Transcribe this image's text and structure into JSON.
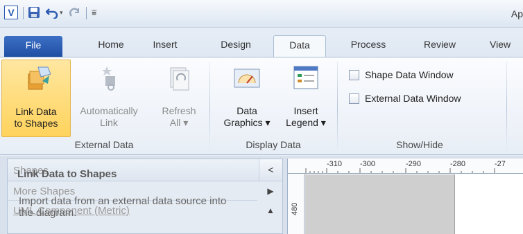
{
  "titlebar": {
    "app_initial": "V",
    "title": "Ap"
  },
  "tabs": [
    {
      "label": "File"
    },
    {
      "label": "Home"
    },
    {
      "label": "Insert"
    },
    {
      "label": "Design"
    },
    {
      "label": "Data"
    },
    {
      "label": "Process"
    },
    {
      "label": "Review"
    },
    {
      "label": "View"
    }
  ],
  "ribbon": {
    "buttons": {
      "link_data": {
        "line1": "Link Data",
        "line2": "to Shapes"
      },
      "auto_link": {
        "line1": "Automatically",
        "line2": "Link"
      },
      "refresh_all": {
        "line1": "Refresh",
        "line2": "All ▾"
      },
      "data_graphics": {
        "line1": "Data",
        "line2": "Graphics ▾"
      },
      "insert_legend": {
        "line1": "Insert",
        "line2": "Legend ▾"
      }
    },
    "checkboxes": {
      "shape_data_window": "Shape Data Window",
      "external_data_window": "External Data Window"
    },
    "groups": {
      "external_data": "External Data",
      "display_data": "Display Data",
      "show_hide": "Show/Hide"
    }
  },
  "shapes_pane": {
    "header": "Shapes",
    "collapse_glyph": "<",
    "rows": [
      {
        "label": "More Shapes",
        "arrow": "▶"
      },
      {
        "label": "UML Component (Metric)",
        "arrow": "▲"
      }
    ]
  },
  "tooltip": {
    "title": "Link Data to Shapes",
    "body": "Import data from an external data source into the diagram."
  },
  "ruler": {
    "h_labels": [
      "-310",
      "-300",
      "-290",
      "-280",
      "-27"
    ],
    "v_label": "480"
  },
  "colors": {
    "file_tab": "#2a5db0",
    "active_button": "#ffd35c",
    "ribbon_bg": "#f6f9fc"
  }
}
